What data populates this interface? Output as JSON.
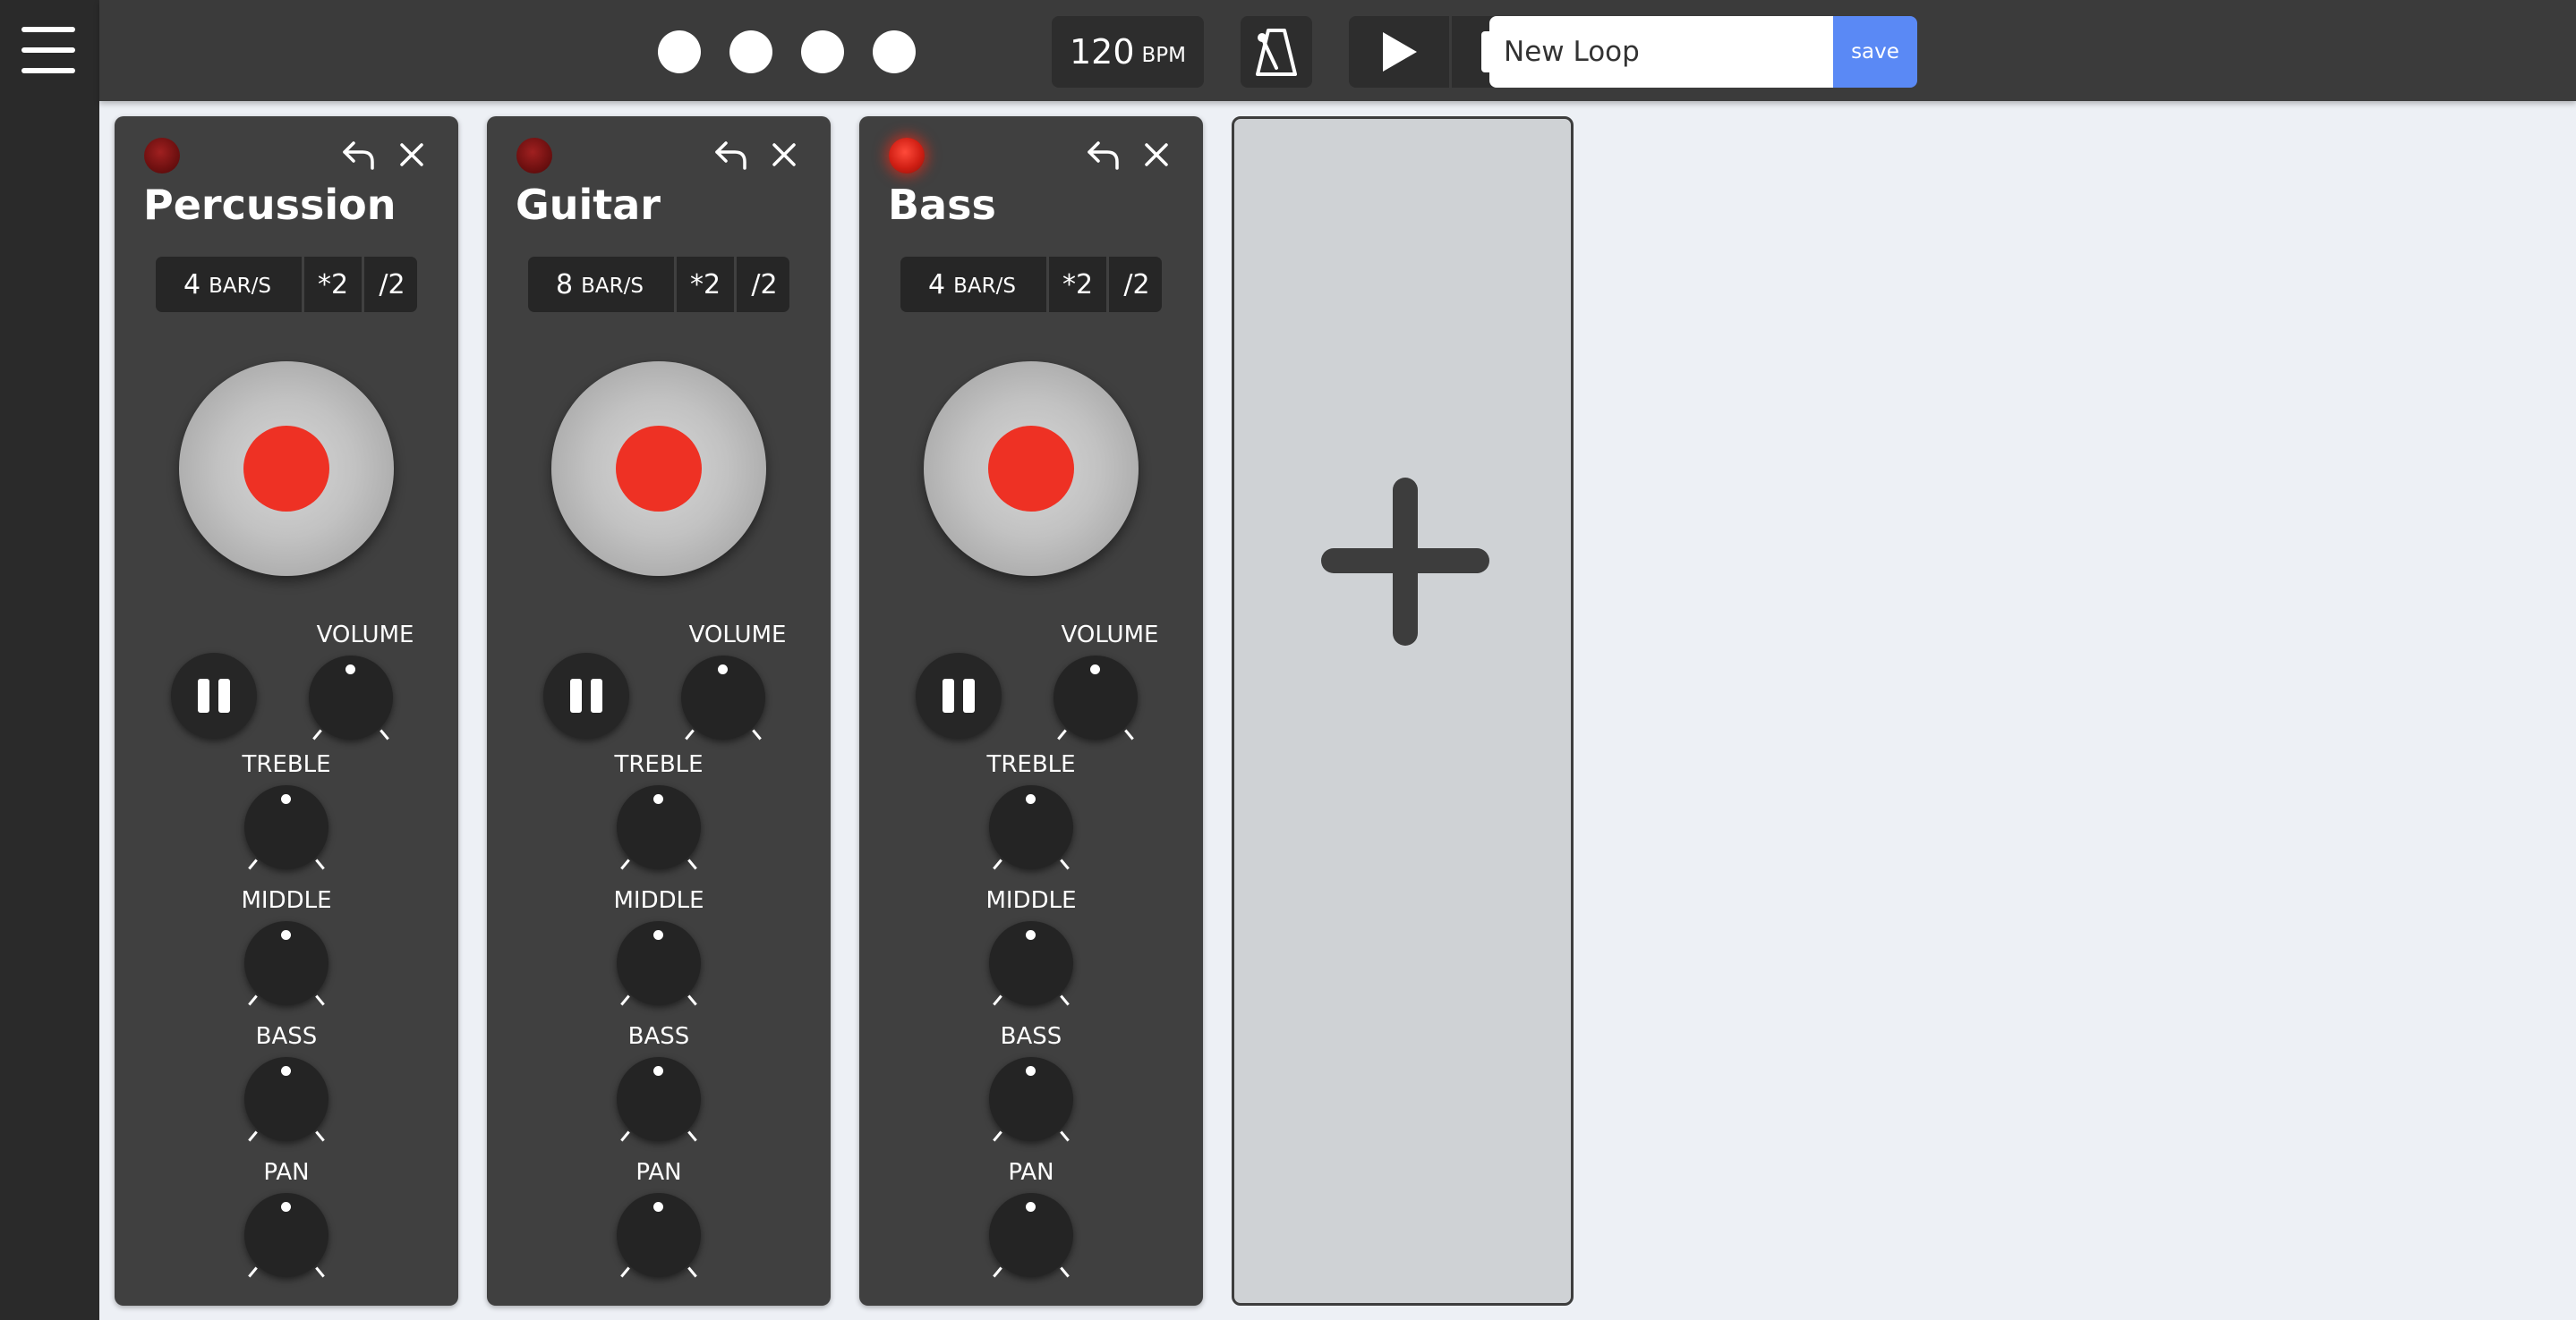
{
  "app": {
    "menu_icon": "hamburger-menu-icon"
  },
  "toolbar": {
    "beat_indicators": [
      "beat-1",
      "beat-2",
      "beat-3",
      "beat-4"
    ],
    "tempo": {
      "value": "120",
      "unit": "BPM"
    },
    "metronome_icon": "metronome-icon",
    "play_icon": "play-icon",
    "stop_icon": "stop-icon",
    "loop_name": {
      "value": "New Loop",
      "placeholder": ""
    },
    "save_label": "save",
    "save_color": "#5a89f5"
  },
  "tracks": [
    {
      "name": "Percussion",
      "recording": false,
      "bars": {
        "value": "4",
        "unit": "BAR/S",
        "multiply_label": "*2",
        "divide_label": "/2"
      },
      "knob_labels": {
        "volume": "VOLUME",
        "treble": "TREBLE",
        "middle": "MIDDLE",
        "bass": "BASS",
        "pan": "PAN"
      }
    },
    {
      "name": "Guitar",
      "recording": false,
      "bars": {
        "value": "8",
        "unit": "BAR/S",
        "multiply_label": "*2",
        "divide_label": "/2"
      },
      "knob_labels": {
        "volume": "VOLUME",
        "treble": "TREBLE",
        "middle": "MIDDLE",
        "bass": "BASS",
        "pan": "PAN"
      }
    },
    {
      "name": "Bass",
      "recording": true,
      "bars": {
        "value": "4",
        "unit": "BAR/S",
        "multiply_label": "*2",
        "divide_label": "/2"
      },
      "knob_labels": {
        "volume": "VOLUME",
        "treble": "TREBLE",
        "middle": "MIDDLE",
        "bass": "BASS",
        "pan": "PAN"
      }
    }
  ],
  "add_track": {
    "icon": "plus-icon"
  },
  "colors": {
    "record": "#ee3124",
    "panel": "#404040",
    "toolbar": "#3b3b3b",
    "workspace": "#edf0f5"
  }
}
